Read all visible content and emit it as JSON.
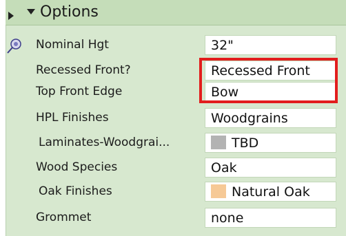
{
  "header": {
    "title": "Options"
  },
  "colors": {
    "panel_bg": "#d7e8cf",
    "header_bg": "#c5ddb9",
    "highlight": "#e21d1d"
  },
  "rows": [
    {
      "label": "Nominal Hgt",
      "value": "32\""
    },
    {
      "label": "Recessed Front?",
      "value": "Recessed Front"
    },
    {
      "label": "Top Front Edge",
      "value": "Bow"
    },
    {
      "label": "HPL Finishes",
      "value": "Woodgrains"
    },
    {
      "label": "Laminates-Woodgrai...",
      "value": "TBD",
      "swatch": "#b3b3b3"
    },
    {
      "label": "Wood Species",
      "value": "Oak"
    },
    {
      "label": "Oak Finishes",
      "value": "Natural Oak",
      "swatch": "#f6c996"
    },
    {
      "label": "Grommet",
      "value": "none"
    }
  ],
  "icons": {
    "expand": "triangle-right-icon",
    "collapse": "triangle-down-icon",
    "pin": "pushpin-icon"
  }
}
